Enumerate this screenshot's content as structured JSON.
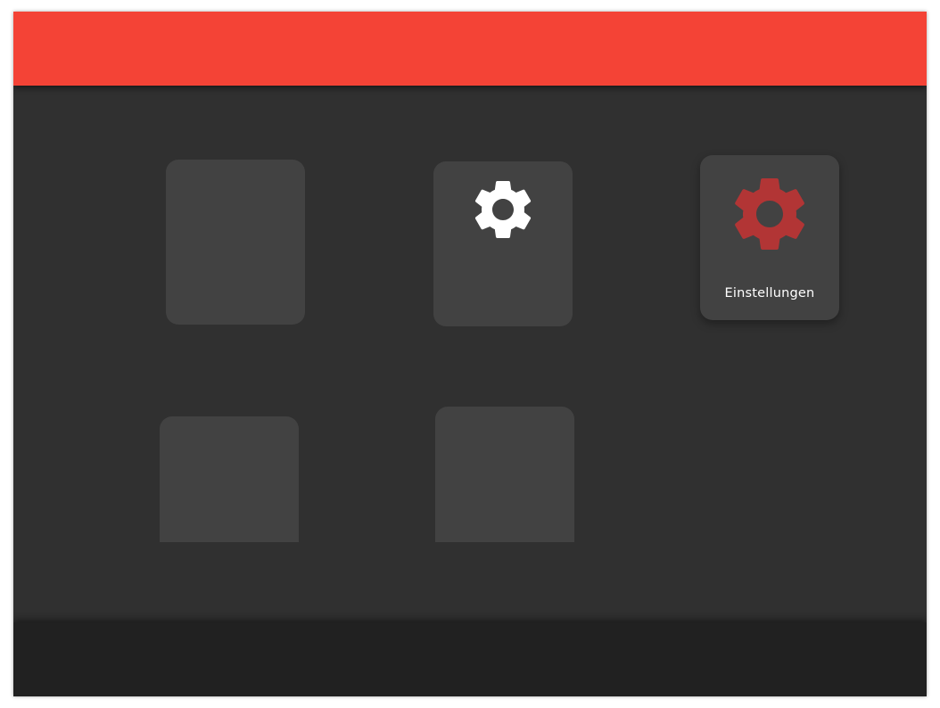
{
  "header": {
    "color": "#f44336"
  },
  "footer": {
    "color": "#212121"
  },
  "tiles": [
    {
      "id": "tile-1",
      "label": "",
      "icon": "none"
    },
    {
      "id": "tile-2",
      "label": "",
      "icon": "gear-icon",
      "icon_color": "#ffffff"
    },
    {
      "id": "tile-3",
      "label": "Einstellungen",
      "icon": "gear-icon",
      "icon_color": "#b23535"
    },
    {
      "id": "tile-4",
      "label": "",
      "icon": "none"
    },
    {
      "id": "tile-5",
      "label": "",
      "icon": "none"
    }
  ]
}
